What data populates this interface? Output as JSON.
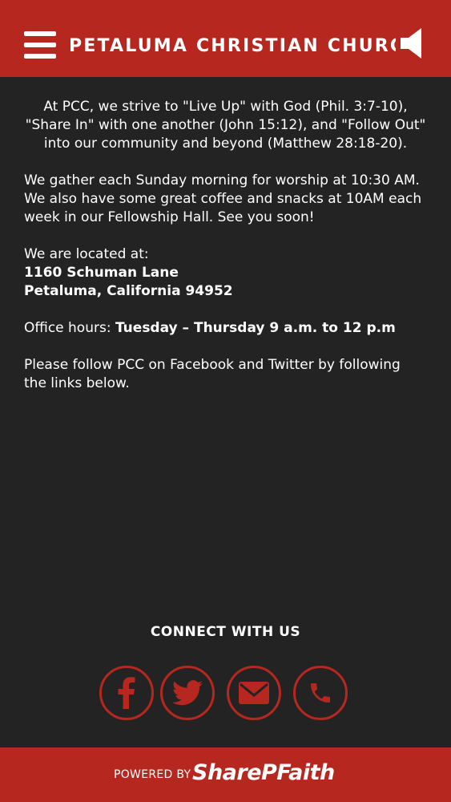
{
  "header": {
    "title": "PETALUMA CHRISTIAN CHURCH"
  },
  "content": {
    "intro": "At PCC, we strive to \"Live Up\" with God (Phil. 3:7-10), \"Share In\" with one another (John 15:12), and \"Follow Out\" into our community and beyond (Matthew 28:18-20).",
    "worship": "We gather each Sunday morning for worship at 10:30 AM.  We also have some great coffee and snacks at 10AM each week in our Fellowship Hall. See you soon!",
    "location_label": "We are located at:",
    "address_line1": "1160 Schuman Lane",
    "address_line2": "Petaluma, California 94952",
    "office_label": "Office hours: ",
    "office_hours": "Tuesday – Thursday 9 a.m. to 12 p.m",
    "follow": "Please follow PCC on Facebook and Twitter by following the links below."
  },
  "connect": {
    "heading": "CONNECT WITH US",
    "icons": [
      "facebook-icon",
      "twitter-icon",
      "email-icon",
      "phone-icon"
    ]
  },
  "footer": {
    "powered_label": "POWERED BY",
    "brand": "SharePFaith"
  },
  "colors": {
    "accent": "#b5271f",
    "background": "#232323",
    "text": "#ffffff"
  }
}
